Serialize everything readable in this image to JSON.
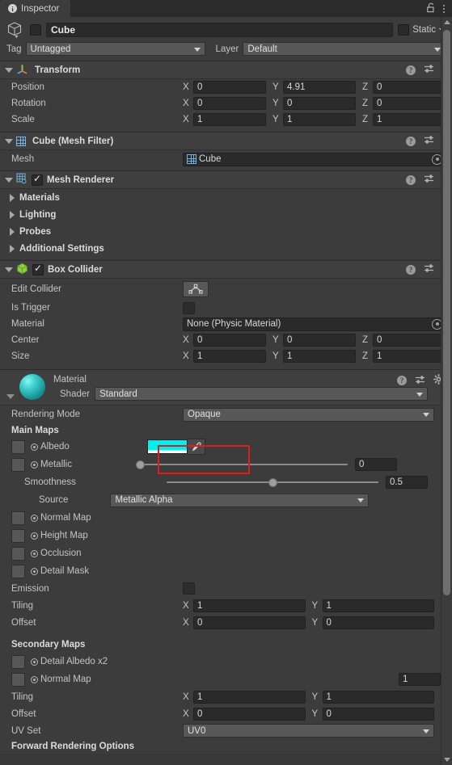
{
  "window": {
    "tab_label": "Inspector",
    "tab_icon": "info-icon",
    "lock_icon": "lock-open-icon",
    "menu_icon": "kebab-menu-icon"
  },
  "object_header": {
    "icon": "cube-icon",
    "enabled": false,
    "name": "Cube",
    "static_label": "Static",
    "static_checked": false,
    "tag_label": "Tag",
    "tag_value": "Untagged",
    "layer_label": "Layer",
    "layer_value": "Default"
  },
  "components": [
    {
      "id": "transform",
      "title": "Transform",
      "icon": "transform-axis-icon",
      "expanded": true,
      "has_checkbox": false,
      "tools": [
        "help-icon",
        "preset-icon",
        "kebab-menu-icon"
      ],
      "rows": [
        {
          "type": "vector3",
          "label": "Position",
          "x": "0",
          "y": "4.91",
          "z": "0"
        },
        {
          "type": "vector3",
          "label": "Rotation",
          "x": "0",
          "y": "0",
          "z": "0"
        },
        {
          "type": "vector3",
          "label": "Scale",
          "x": "1",
          "y": "1",
          "z": "1"
        }
      ]
    },
    {
      "id": "mesh-filter",
      "title": "Cube (Mesh Filter)",
      "icon": "mesh-filter-icon",
      "expanded": true,
      "has_checkbox": false,
      "tools": [
        "help-icon",
        "preset-icon",
        "kebab-menu-icon"
      ],
      "rows": [
        {
          "type": "object",
          "label": "Mesh",
          "value": "Cube",
          "value_icon": "mesh-icon"
        }
      ]
    },
    {
      "id": "mesh-renderer",
      "title": "Mesh Renderer",
      "icon": "mesh-renderer-icon",
      "expanded": true,
      "has_checkbox": true,
      "checked": true,
      "tools": [
        "help-icon",
        "preset-icon",
        "kebab-menu-icon"
      ],
      "foldouts": [
        "Materials",
        "Lighting",
        "Probes",
        "Additional Settings"
      ]
    },
    {
      "id": "box-collider",
      "title": "Box Collider",
      "icon": "box-collider-icon",
      "expanded": true,
      "has_checkbox": true,
      "checked": true,
      "tools": [
        "help-icon",
        "preset-icon",
        "kebab-menu-icon"
      ],
      "rows": [
        {
          "type": "button",
          "label": "Edit Collider",
          "button_icon": "edit-collider-icon"
        },
        {
          "type": "checkbox",
          "label": "Is Trigger",
          "checked": false
        },
        {
          "type": "object",
          "label": "Material",
          "value": "None (Physic Material)"
        },
        {
          "type": "vector3",
          "label": "Center",
          "x": "0",
          "y": "0",
          "z": "0"
        },
        {
          "type": "vector3",
          "label": "Size",
          "x": "1",
          "y": "1",
          "z": "1"
        }
      ]
    }
  ],
  "material": {
    "title": "Material",
    "preview_icon": "material-sphere-preview",
    "shader_label": "Shader",
    "shader_value": "Standard",
    "tools": [
      "help-icon",
      "preset-icon",
      "gear-icon"
    ],
    "rendering_mode_label": "Rendering Mode",
    "rendering_mode_value": "Opaque",
    "main_maps_header": "Main Maps",
    "albedo_label": "Albedo",
    "albedo_color": "#00F0F0",
    "eyedropper_icon": "eyedropper-icon",
    "metallic_label": "Metallic",
    "metallic_value": "0",
    "smoothness_label": "Smoothness",
    "smoothness_value": "0.5",
    "source_label": "Source",
    "source_value": "Metallic Alpha",
    "normal_map_label": "Normal Map",
    "height_map_label": "Height Map",
    "occlusion_label": "Occlusion",
    "detail_mask_label": "Detail Mask",
    "emission_label": "Emission",
    "emission_checked": false,
    "tiling_label": "Tiling",
    "tiling_x": "1",
    "tiling_y": "1",
    "offset_label": "Offset",
    "offset_x": "0",
    "offset_y": "0",
    "secondary_maps_header": "Secondary Maps",
    "detail_albedo_label": "Detail Albedo x2",
    "secondary_normal_label": "Normal Map",
    "secondary_normal_value": "1",
    "secondary_tiling_label": "Tiling",
    "secondary_tiling_x": "1",
    "secondary_tiling_y": "1",
    "secondary_offset_label": "Offset",
    "secondary_offset_x": "0",
    "secondary_offset_y": "0",
    "uv_set_label": "UV Set",
    "uv_set_value": "UV0",
    "forward_rendering_header": "Forward Rendering Options"
  },
  "highlight": {
    "color": "#E01B1B",
    "target": "albedo-color-swatch"
  },
  "axis": {
    "x": "X",
    "y": "Y",
    "z": "Z"
  }
}
